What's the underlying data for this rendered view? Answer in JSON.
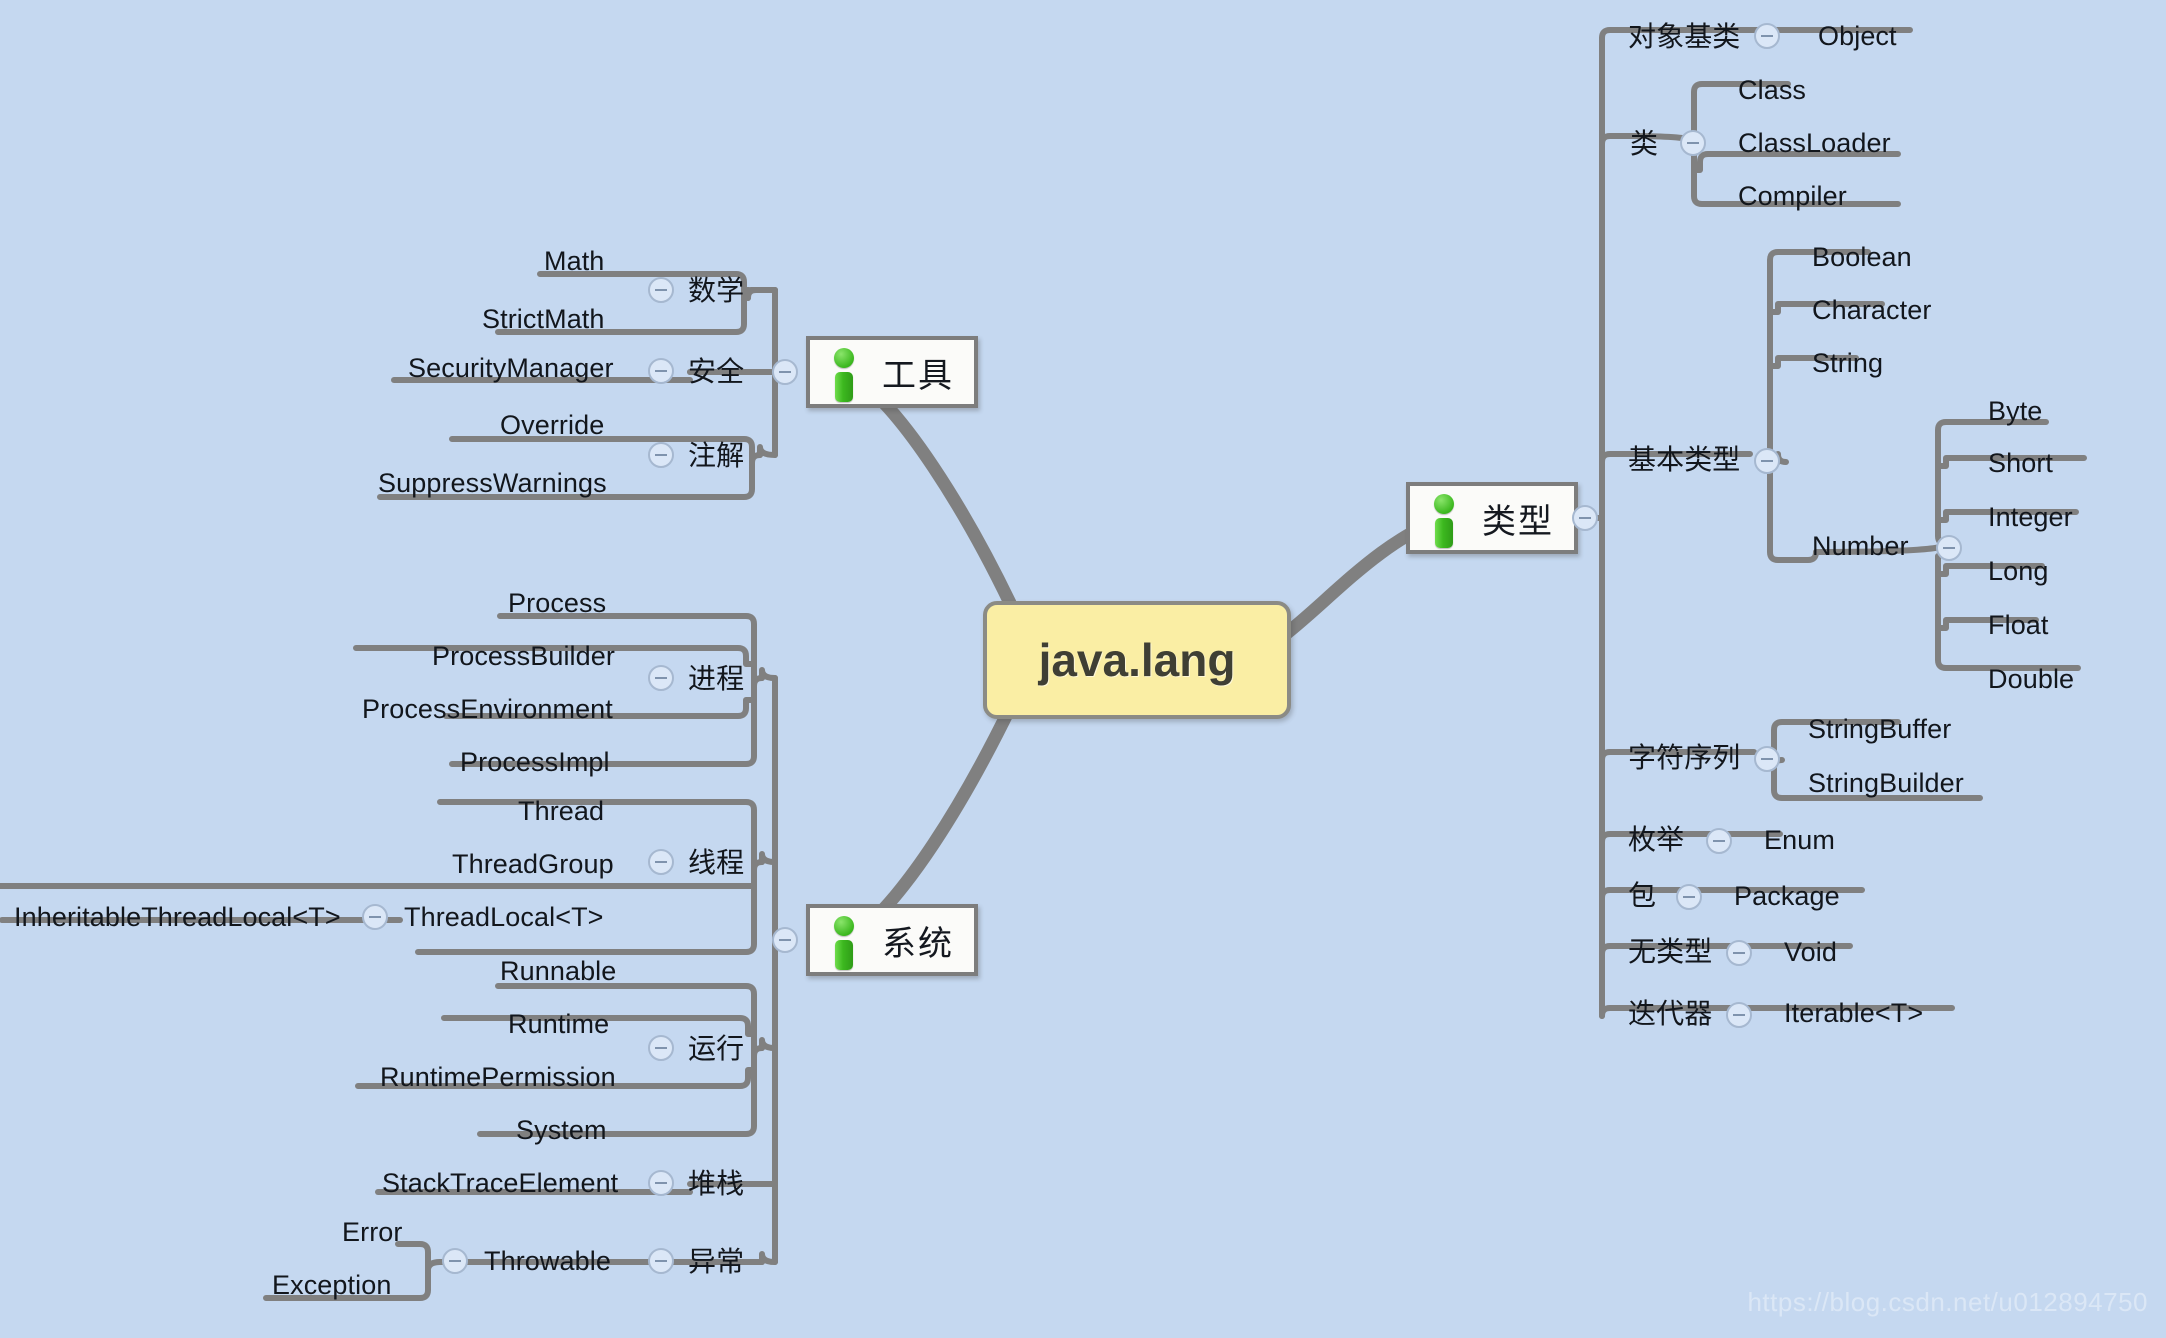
{
  "document": {
    "title": "java.lang",
    "watermark": "https://blog.csdn.net/u012894750",
    "background_color": "#c5d8f0",
    "root_fill": "#faeea4",
    "root_border": "#8b8b85",
    "branch_fill": "#fbfbf9",
    "branch_border": "#7d7d7d",
    "line_color": "#808080",
    "text_color": "#12161c",
    "icon_color": "#3cb81f"
  },
  "root": {
    "label": "java.lang"
  },
  "branches": [
    {
      "id": "tools",
      "label": "工具",
      "icon": "info-icon",
      "side": "left",
      "groups": [
        {
          "label": "数学",
          "children": [
            "Math",
            "StrictMath"
          ]
        },
        {
          "label": "安全",
          "children": [
            "SecurityManager"
          ]
        },
        {
          "label": "注解",
          "children": [
            "Override",
            "SuppressWarnings"
          ]
        }
      ]
    },
    {
      "id": "system",
      "label": "系统",
      "icon": "info-icon",
      "side": "left",
      "groups": [
        {
          "label": "进程",
          "children": [
            "Process",
            "ProcessBuilder",
            "ProcessEnvironment",
            "ProcessImpl"
          ]
        },
        {
          "label": "线程",
          "children": [
            "Thread",
            "ThreadGroup",
            "ThreadLocal<T>"
          ],
          "grandchildren": {
            "ThreadLocal<T>": [
              "InheritableThreadLocal<T>"
            ]
          }
        },
        {
          "label": "运行",
          "children": [
            "Runnable",
            "Runtime",
            "RuntimePermission",
            "System"
          ]
        },
        {
          "label": "堆栈",
          "children": [
            "StackTraceElement"
          ]
        },
        {
          "label": "异常",
          "children": [
            "Throwable"
          ],
          "grandchildren": {
            "Throwable": [
              "Error",
              "Exception"
            ]
          }
        }
      ]
    },
    {
      "id": "types",
      "label": "类型",
      "icon": "info-icon",
      "side": "right",
      "groups": [
        {
          "label": "对象基类",
          "children": [
            "Object"
          ]
        },
        {
          "label": "类",
          "children": [
            "Class",
            "ClassLoader",
            "Compiler"
          ]
        },
        {
          "label": "基本类型",
          "children": [
            "Boolean",
            "Character",
            "String",
            "Number"
          ],
          "grandchildren": {
            "Number": [
              "Byte",
              "Short",
              "Integer",
              "Long",
              "Float",
              "Double"
            ]
          }
        },
        {
          "label": "字符序列",
          "children": [
            "StringBuffer",
            "StringBuilder"
          ]
        },
        {
          "label": "枚举",
          "children": [
            "Enum"
          ]
        },
        {
          "label": "包",
          "children": [
            "Package"
          ]
        },
        {
          "label": "无类型",
          "children": [
            "Void"
          ]
        },
        {
          "label": "迭代器",
          "children": [
            "Iterable<T>"
          ]
        }
      ]
    }
  ],
  "labels": {
    "math": "数学",
    "security": "安全",
    "annotation": "注解",
    "process": "进程",
    "thread": "线程",
    "runtime": "运行",
    "stack": "堆栈",
    "exception": "异常",
    "object_base": "对象基类",
    "classes": "类",
    "primitives": "基本类型",
    "charseq": "字符序列",
    "enum": "枚举",
    "package": "包",
    "void": "无类型",
    "iterator": "迭代器",
    "tools": "工具",
    "system": "系统",
    "types": "类型",
    "math_1": "Math",
    "math_2": "StrictMath",
    "security_1": "SecurityManager",
    "annotation_1": "Override",
    "annotation_2": "SuppressWarnings",
    "process_1": "Process",
    "process_2": "ProcessBuilder",
    "process_3": "ProcessEnvironment",
    "process_4": "ProcessImpl",
    "thread_1": "Thread",
    "thread_2": "ThreadGroup",
    "thread_3": "ThreadLocal<T>",
    "thread_3_1": "InheritableThreadLocal<T>",
    "runtime_1": "Runnable",
    "runtime_2": "Runtime",
    "runtime_3": "RuntimePermission",
    "runtime_4": "System",
    "stack_1": "StackTraceElement",
    "exception_1": "Throwable",
    "exception_1_1": "Error",
    "exception_1_2": "Exception",
    "object_1": "Object",
    "class_1": "Class",
    "class_2": "ClassLoader",
    "class_3": "Compiler",
    "prim_1": "Boolean",
    "prim_2": "Character",
    "prim_3": "String",
    "prim_4": "Number",
    "num_1": "Byte",
    "num_2": "Short",
    "num_3": "Integer",
    "num_4": "Long",
    "num_5": "Float",
    "num_6": "Double",
    "charseq_1": "StringBuffer",
    "charseq_2": "StringBuilder",
    "enum_1": "Enum",
    "package_1": "Package",
    "void_1": "Void",
    "iterator_1": "Iterable<T>"
  }
}
